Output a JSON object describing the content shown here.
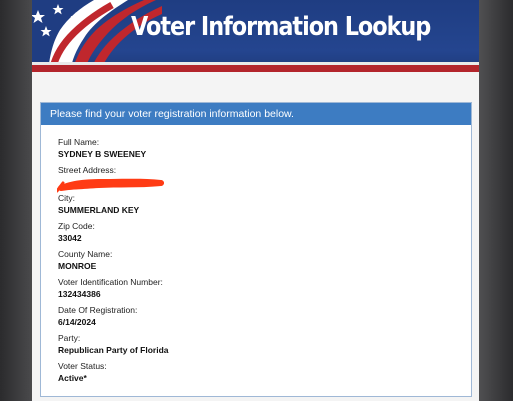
{
  "banner": {
    "title": "Voter Information Lookup"
  },
  "panel": {
    "heading": "Please find your voter registration information below."
  },
  "fields": [
    {
      "label": "Full Name:",
      "value": "SYDNEY B SWEENEY"
    },
    {
      "label": "Street Address:",
      "value": ""
    },
    {
      "label": "City:",
      "value": "SUMMERLAND KEY"
    },
    {
      "label": "Zip Code:",
      "value": "33042"
    },
    {
      "label": "County Name:",
      "value": "MONROE"
    },
    {
      "label": "Voter Identification Number:",
      "value": "132434386"
    },
    {
      "label": "Date Of Registration:",
      "value": "6/14/2024"
    },
    {
      "label": "Party:",
      "value": "Republican Party of Florida"
    },
    {
      "label": "Voter Status:",
      "value": "Active*"
    }
  ],
  "colors": {
    "banner_blue": "#24458f",
    "stripe_red": "#b3252c",
    "panel_header": "#3d7cc2",
    "redaction": "#ff3b14"
  },
  "icons": [
    "american-flag-icon"
  ]
}
